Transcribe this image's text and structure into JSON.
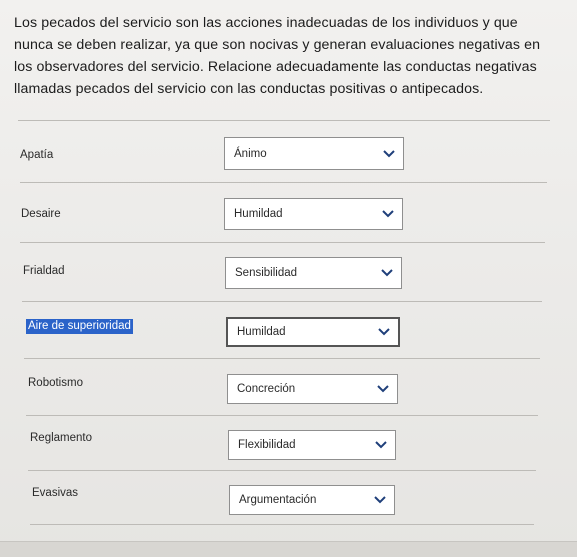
{
  "question": {
    "text": "Los pecados del servicio son las acciones inadecuadas de los individuos y que nunca se deben realizar, ya que son nocivas y generan evaluaciones negativas en los observadores del servicio. Relacione adecuadamente las conductas negativas llamadas pecados del servicio con las conductas positivas o antipecados."
  },
  "rows": [
    {
      "label": "Apatía",
      "selected": "Ánimo",
      "highlighted": false
    },
    {
      "label": "Desaire",
      "selected": "Humildad",
      "highlighted": false
    },
    {
      "label": "Frialdad",
      "selected": "Sensibilidad",
      "highlighted": false
    },
    {
      "label": "Aire de superioridad",
      "selected": "Humildad",
      "highlighted": true
    },
    {
      "label": "Robotismo",
      "selected": "Concreción",
      "highlighted": false
    },
    {
      "label": "Reglamento",
      "selected": "Flexibilidad",
      "highlighted": false
    },
    {
      "label": "Evasivas",
      "selected": "Argumentación",
      "highlighted": false
    }
  ],
  "icons": {
    "dropdown": "chevron-down-icon"
  },
  "colors": {
    "highlight": "#2b63c9",
    "select_border": "#8f8f8f",
    "background": "#ecebe9"
  }
}
